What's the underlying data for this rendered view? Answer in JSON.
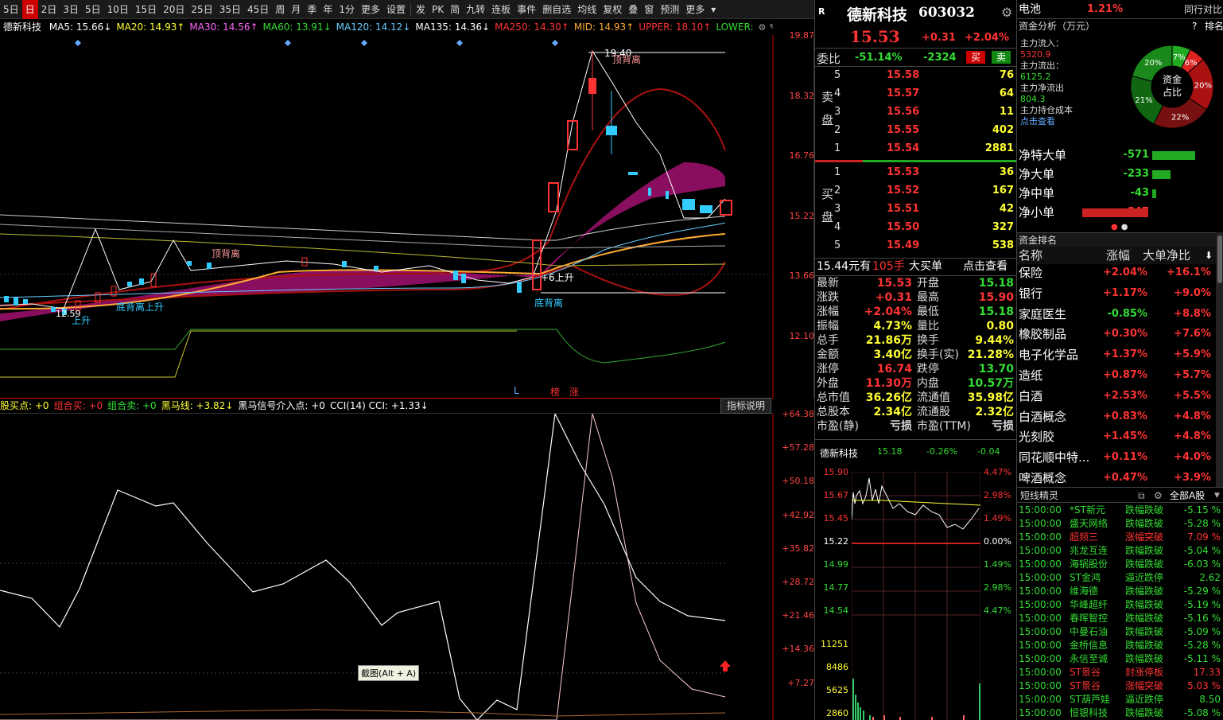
{
  "toolbar": {
    "periods": [
      "5日",
      "日",
      "2日",
      "3日",
      "5日",
      "10日",
      "15日",
      "20日",
      "25日",
      "35日",
      "45日",
      "周",
      "月",
      "季",
      "年",
      "1分",
      "更多",
      "设置"
    ],
    "active_period": "日",
    "tools": [
      "发",
      "PK",
      "简",
      "九转",
      "连板",
      "事件",
      "删自选",
      "均线",
      "复权",
      "叠",
      "窗",
      "预测",
      "更多"
    ]
  },
  "ma_legend": {
    "stock": "德新科技",
    "items": [
      {
        "text": "MA5: 15.66↓",
        "color": "#ffffff"
      },
      {
        "text": "MA20: 14.93↑",
        "color": "#ffff33"
      },
      {
        "text": "MA30: 14.56↑",
        "color": "#ff66ff"
      },
      {
        "text": "MA60: 13.91↓",
        "color": "#33dd33"
      },
      {
        "text": "MA120: 14.12↓",
        "color": "#66ccff"
      },
      {
        "text": "MA135: 14.36↓",
        "color": "#ffffff"
      },
      {
        "text": "MA250: 14.30↑",
        "color": "#ff3333"
      },
      {
        "text": "MID: 14.93↑",
        "color": "#ffaa33"
      },
      {
        "text": "UPPER: 18.10↑",
        "color": "#ff3333"
      },
      {
        "text": "LOWER:",
        "color": "#33dd33"
      }
    ]
  },
  "kline": {
    "price_axis": [
      "19.87",
      "18.32",
      "16.76",
      "15.22",
      "13.66",
      "12.10"
    ],
    "annotations": {
      "peak": "19.40",
      "low": "12.59",
      "div_top": "顶背离",
      "div_top2": "顶背离",
      "div_bottom": "底背离",
      "bottom_up": "底背离上升",
      "up1": "上升",
      "up2": "+6上升",
      "marks": [
        "L",
        "榜",
        "涨"
      ]
    }
  },
  "indicator": {
    "legend": [
      {
        "text": "股买点: +0",
        "color": "#ffff33"
      },
      {
        "text": "组合买: +0",
        "color": "#ff3333"
      },
      {
        "text": "组合卖: +0",
        "color": "#33dd33"
      },
      {
        "text": "黑马线: +3.82↓",
        "color": "#ffff33"
      },
      {
        "text": "黑马信号介入点: +0",
        "color": "#ffffff"
      },
      {
        "text": "CCI(14) CCI: +1.33↓",
        "color": "#ffffff"
      }
    ],
    "explain_button": "指标说明",
    "axis": [
      "+64.38",
      "+57.28",
      "+50.18",
      "+42.92",
      "+35.82",
      "+28.72",
      "+21.46",
      "+14.36",
      "+7.27"
    ],
    "tooltip": "截图(Alt + A)"
  },
  "quote": {
    "name": "德新科技",
    "code": "603032",
    "price": "15.53",
    "change": "+0.31",
    "pct": "+2.04%",
    "weibi_label": "委比",
    "weibi": "-51.14%",
    "weicha": "-2324",
    "buy_btn": "买",
    "sell_btn": "卖",
    "sell_label": "卖盘",
    "buy_label": "买盘",
    "asks": [
      {
        "n": "5",
        "p": "15.58",
        "v": "76"
      },
      {
        "n": "4",
        "p": "15.57",
        "v": "64"
      },
      {
        "n": "3",
        "p": "15.56",
        "v": "11"
      },
      {
        "n": "2",
        "p": "15.55",
        "v": "402"
      },
      {
        "n": "1",
        "p": "15.54",
        "v": "2881"
      }
    ],
    "bids": [
      {
        "n": "1",
        "p": "15.53",
        "v": "36"
      },
      {
        "n": "2",
        "p": "15.52",
        "v": "167"
      },
      {
        "n": "3",
        "p": "15.51",
        "v": "42"
      },
      {
        "n": "4",
        "p": "15.50",
        "v": "327"
      },
      {
        "n": "5",
        "p": "15.49",
        "v": "538"
      }
    ],
    "big_order": {
      "price": "15.44元有",
      "qty": "105手",
      "label": "大买单",
      "link": "点击查看"
    },
    "stats": [
      {
        "k1": "最新",
        "v1": "15.53",
        "c1": "#ff3333",
        "k2": "开盘",
        "v2": "15.18",
        "c2": "#33dd33"
      },
      {
        "k1": "涨跌",
        "v1": "+0.31",
        "c1": "#ff3333",
        "k2": "最高",
        "v2": "15.90",
        "c2": "#ff3333"
      },
      {
        "k1": "涨幅",
        "v1": "+2.04%",
        "c1": "#ff3333",
        "k2": "最低",
        "v2": "15.18",
        "c2": "#33dd33"
      },
      {
        "k1": "振幅",
        "v1": "4.73%",
        "c1": "#ffff33",
        "k2": "量比",
        "v2": "0.80",
        "c2": "#ffff33"
      },
      {
        "k1": "总手",
        "v1": "21.86万",
        "c1": "#ffff33",
        "k2": "换手",
        "v2": "9.44%",
        "c2": "#ffff33"
      },
      {
        "k1": "金额",
        "v1": "3.40亿",
        "c1": "#ffff33",
        "k2": "换手(实)",
        "v2": "21.28%",
        "c2": "#ffff33"
      },
      {
        "k1": "涨停",
        "v1": "16.74",
        "c1": "#ff3333",
        "k2": "跌停",
        "v2": "13.70",
        "c2": "#33dd33"
      },
      {
        "k1": "外盘",
        "v1": "11.30万",
        "c1": "#ff3333",
        "k2": "内盘",
        "v2": "10.57万",
        "c2": "#33dd33"
      },
      {
        "k1": "总市值",
        "v1": "36.26亿",
        "c1": "#ffff33",
        "k2": "流通值",
        "v2": "35.98亿",
        "c2": "#ffff33"
      },
      {
        "k1": "总股本",
        "v1": "2.34亿",
        "c1": "#ffff33",
        "k2": "流通股",
        "v2": "2.32亿",
        "c2": "#ffff33"
      },
      {
        "k1": "市盈(静)",
        "v1": "亏损",
        "c1": "#dddddd",
        "k2": "市盈(TTM)",
        "v2": "亏损",
        "c2": "#dddddd"
      }
    ],
    "mini": {
      "name": "德新科技",
      "price": "15.18",
      "pct": "-0.26%",
      "chg": "-0.04",
      "left_axis": [
        "15.90",
        "15.67",
        "15.45",
        "15.22",
        "14.99",
        "14.77",
        "14.54",
        "11251",
        "8486",
        "5625",
        "2860"
      ],
      "right_axis": [
        "4.47%",
        "2.98%",
        "1.49%",
        "0.00%",
        "1.49%",
        "2.98%",
        "4.47%"
      ]
    }
  },
  "capital": {
    "sector": "电池",
    "sector_pct": "1.21%",
    "peer": "同行对比",
    "title": "资金分析（万元）",
    "help": "?",
    "rank_link": "排名",
    "inflow_label": "主力流入：",
    "inflow": "5320.9",
    "outflow_label": "主力流出：",
    "outflow": "6125.2",
    "net_label": "主力净流出",
    "net": "804.3",
    "cost_label": "主力持仓成本",
    "cost_link": "点击查看",
    "donut_center": [
      "资金",
      "占比"
    ],
    "donut": [
      {
        "label": "7%",
        "value": 7,
        "color": "#22aa22"
      },
      {
        "label": "6%",
        "value": 6,
        "color": "#dd2222"
      },
      {
        "label": "20%",
        "value": 20,
        "color": "#aa1111"
      },
      {
        "label": "22%",
        "value": 22,
        "color": "#771111"
      },
      {
        "label": "21%",
        "value": 21,
        "color": "#116611"
      },
      {
        "label": "20%",
        "value": 20,
        "color": "#1a881a"
      }
    ],
    "net_rows": [
      {
        "label": "净特大单",
        "value": "-571",
        "color": "#33dd33",
        "bar": 0.6
      },
      {
        "label": "净大单",
        "value": "-233",
        "color": "#33dd33",
        "bar": 0.26
      },
      {
        "label": "净中单",
        "value": "-43",
        "color": "#33dd33",
        "bar": 0.05
      },
      {
        "label": "净小单",
        "value": "847",
        "color": "#ff3333",
        "bar": 0.92
      }
    ],
    "rank_title": "资金排名",
    "rank_headers": [
      "名称",
      "涨幅",
      "大单净比"
    ],
    "ranks": [
      {
        "n": "保险",
        "p": "+2.04%",
        "q": "+16.1%"
      },
      {
        "n": "银行",
        "p": "+1.17%",
        "q": "+9.0%"
      },
      {
        "n": "家庭医生",
        "p": "-0.85%",
        "q": "+8.8%"
      },
      {
        "n": "橡胶制品",
        "p": "+0.30%",
        "q": "+7.6%"
      },
      {
        "n": "电子化学品",
        "p": "+1.37%",
        "q": "+5.9%"
      },
      {
        "n": "造纸",
        "p": "+0.87%",
        "q": "+5.7%"
      },
      {
        "n": "白酒",
        "p": "+2.53%",
        "q": "+5.5%"
      },
      {
        "n": "白酒概念",
        "p": "+0.83%",
        "q": "+4.8%"
      },
      {
        "n": "光刻胶",
        "p": "+1.45%",
        "q": "+4.8%"
      },
      {
        "n": "同花顺中特...",
        "p": "+0.11%",
        "q": "+4.0%"
      },
      {
        "n": "啤酒概念",
        "p": "+0.47%",
        "q": "+3.9%"
      }
    ],
    "spirit_title": "短线精灵",
    "spirit_filter": "全部A股",
    "spirits": [
      {
        "t": "15:00:00",
        "s": "*ST新元",
        "e": "跌幅跌破",
        "v": "-5.15 %",
        "c": "#33dd33"
      },
      {
        "t": "15:00:00",
        "s": "盛天网络",
        "e": "跌幅跌破",
        "v": "-5.28 %",
        "c": "#33dd33"
      },
      {
        "t": "15:00:00",
        "s": "超频三",
        "e": "涨幅突破",
        "v": "7.09 %",
        "c": "#ff3333"
      },
      {
        "t": "15:00:00",
        "s": "兆龙互连",
        "e": "跌幅跌破",
        "v": "-5.04 %",
        "c": "#33dd33"
      },
      {
        "t": "15:00:00",
        "s": "海锅股份",
        "e": "跌幅跌破",
        "v": "-6.03 %",
        "c": "#33dd33"
      },
      {
        "t": "15:00:00",
        "s": "ST金鸿",
        "e": "逼近跌停",
        "v": "2.62",
        "c": "#33dd33"
      },
      {
        "t": "15:00:00",
        "s": "维海德",
        "e": "跌幅跌破",
        "v": "-5.29 %",
        "c": "#33dd33"
      },
      {
        "t": "15:00:00",
        "s": "华峰超纤",
        "e": "跌幅跌破",
        "v": "-5.19 %",
        "c": "#33dd33"
      },
      {
        "t": "15:00:00",
        "s": "春晖智控",
        "e": "跌幅跌破",
        "v": "-5.16 %",
        "c": "#33dd33"
      },
      {
        "t": "15:00:00",
        "s": "中曼石油",
        "e": "跌幅跌破",
        "v": "-5.09 %",
        "c": "#33dd33"
      },
      {
        "t": "15:00:00",
        "s": "金桥信息",
        "e": "跌幅跌破",
        "v": "-5.28 %",
        "c": "#33dd33"
      },
      {
        "t": "15:00:00",
        "s": "永信至诚",
        "e": "跌幅跌破",
        "v": "-5.11 %",
        "c": "#33dd33"
      },
      {
        "t": "15:00:00",
        "s": "ST景谷",
        "e": "封涨停板",
        "v": "17.33",
        "c": "#ff3333"
      },
      {
        "t": "15:00:00",
        "s": "ST景谷",
        "e": "涨幅突破",
        "v": "5.03 %",
        "c": "#ff3333"
      },
      {
        "t": "15:00:00",
        "s": "ST葫芦娃",
        "e": "逼近跌停",
        "v": "8.50",
        "c": "#33dd33"
      },
      {
        "t": "15:00:00",
        "s": "恒银科技",
        "e": "跌幅跌破",
        "v": "-5.08 %",
        "c": "#33dd33"
      }
    ]
  }
}
